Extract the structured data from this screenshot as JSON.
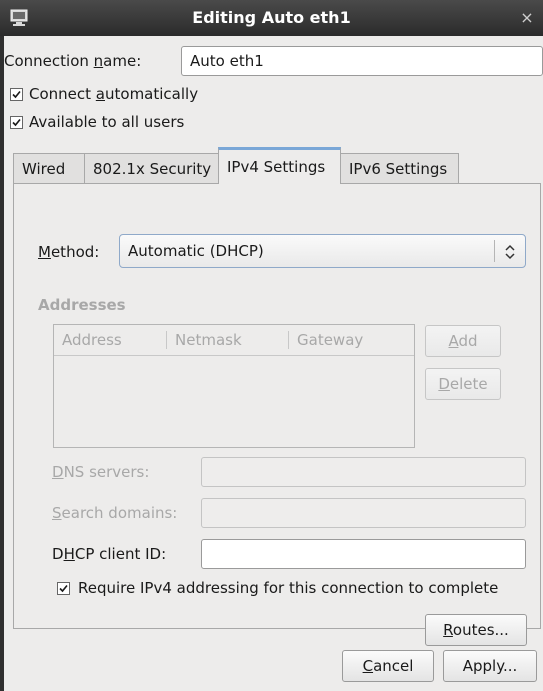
{
  "window": {
    "title": "Editing Auto eth1",
    "close_glyph": "×",
    "icon": "network-connection-icon"
  },
  "connection": {
    "name_label_pre": "Connection ",
    "name_label_u": "n",
    "name_label_post": "ame:",
    "name_value": "Auto eth1",
    "connect_auto_pre": "Connect ",
    "connect_auto_u": "a",
    "connect_auto_post": "utomatically",
    "connect_auto_checked": true,
    "all_users_label": "Available to all users",
    "all_users_checked": true
  },
  "tabs": [
    {
      "label": "Wired",
      "active": false
    },
    {
      "label": "802.1x Security",
      "active": false
    },
    {
      "label": "IPv4 Settings",
      "active": true
    },
    {
      "label": "IPv6 Settings",
      "active": false
    }
  ],
  "ipv4": {
    "method_label_u": "M",
    "method_label_post": "ethod:",
    "method_value": "Automatic (DHCP)",
    "addresses_heading": "Addresses",
    "columns": [
      "Address",
      "Netmask",
      "Gateway"
    ],
    "add_label_u": "A",
    "add_label_post": "dd",
    "delete_label_u": "D",
    "delete_label_post": "elete",
    "dns_label_u": "D",
    "dns_label_post": "NS servers:",
    "dns_value": "",
    "search_label_u": "S",
    "search_label_post": "earch domains:",
    "search_value": "",
    "dhcp_label_pre": "D",
    "dhcp_label_u": "H",
    "dhcp_label_post": "CP client ID:",
    "dhcp_value": "",
    "require_label": "Require IPv4 addressing for this connection to complete",
    "require_checked": true,
    "routes_label_u": "R",
    "routes_label_post": "outes..."
  },
  "footer": {
    "cancel_label_u": "C",
    "cancel_label_post": "ancel",
    "apply_label": "Apply..."
  }
}
